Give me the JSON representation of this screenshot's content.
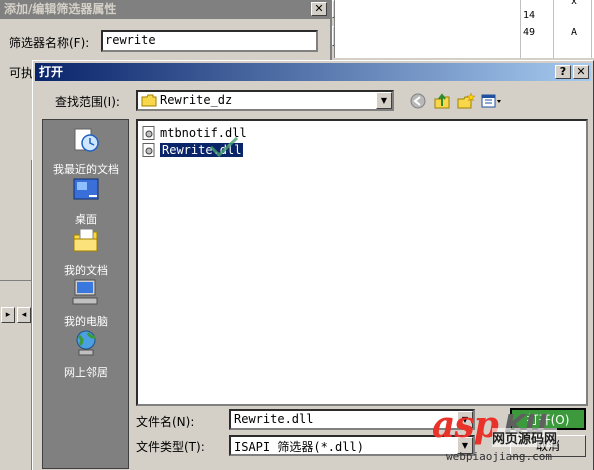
{
  "bg_dialog": {
    "title": "添加/编辑筛选器属性",
    "close_glyph": "✕",
    "name_label": "筛选器名称(F):",
    "name_value": "rewrite",
    "exec_label": "可执",
    "top_btn_text": "..."
  },
  "right_pane": {
    "line1": "14",
    "line2_num": "49",
    "line2_char": "A",
    "line0_char": "x"
  },
  "dialog": {
    "title": "打开",
    "help_glyph": "?",
    "close_glyph": "✕",
    "look_in_label": "查找范围(I):",
    "look_in_value": "Rewrite_dz",
    "filename_label": "文件名(N):",
    "filename_value": "Rewrite.dll",
    "filetype_label": "文件类型(T):",
    "filetype_value": "ISAPI 筛选器(*.dll)",
    "open_button": "打开(O)",
    "cancel_button": "取消"
  },
  "places": [
    {
      "label": "我最近的文档",
      "icon": "recent-docs-icon"
    },
    {
      "label": "桌面",
      "icon": "desktop-icon"
    },
    {
      "label": "我的文档",
      "icon": "my-documents-icon"
    },
    {
      "label": "我的电脑",
      "icon": "my-computer-icon"
    },
    {
      "label": "网上邻居",
      "icon": "network-icon"
    }
  ],
  "files": [
    {
      "name": "mtbnotif.dll",
      "selected": false
    },
    {
      "name": "Rewrite.dll",
      "selected": true
    }
  ],
  "watermark": {
    "brand": "asp",
    "brand2": "KU",
    "sub": "网页源码网",
    "url": "webpiaojiang.com"
  },
  "colors": {
    "title_start": "#0a246a",
    "title_end": "#a6caf0",
    "face": "#d4d0c8",
    "selection": "#0a246a",
    "open_button": "#3c9a3c",
    "watermark_red": "#e8322a"
  }
}
